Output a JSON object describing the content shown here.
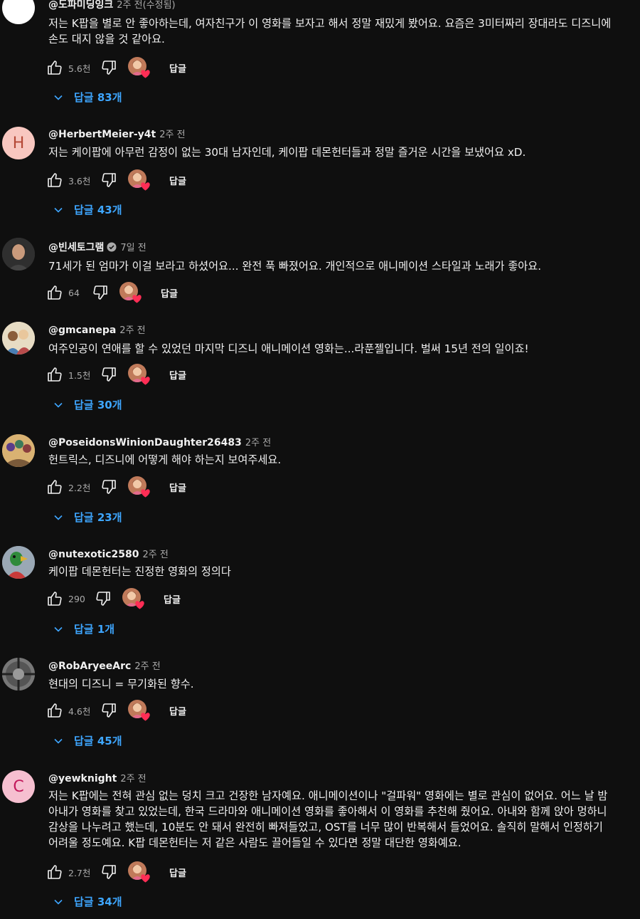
{
  "reply_label": "답글",
  "comments": [
    {
      "handle": "@도파미딩잉크",
      "time": "2주 전(수정됨)",
      "text": "저는 K팝을 별로 안 좋아하는데, 여자친구가 이 영화를 보자고 해서 정말 재밌게 봤어요. 요즘은 3미터짜리 장대라도 디즈니에 손도 대지 않을 것 같아요.",
      "likes": "5.6천",
      "replies": "답글 83개",
      "avatar_letter": "",
      "avatar_color": "#ffffff"
    },
    {
      "handle": "@HerbertMeier-y4t",
      "time": "2주 전",
      "text": "저는 케이팝에 아무런 감정이 없는 30대 남자인데, 케이팝 데몬헌터들과 정말 즐거운 시간을 보냈어요 xD.",
      "likes": "3.6천",
      "replies": "답글 43개",
      "avatar_letter": "H",
      "avatar_color": "#f8c7c0"
    },
    {
      "handle": "@빈세토그램",
      "time": "7일 전",
      "text": "71세가 된 엄마가 이걸 보라고 하셨어요... 완전 푹 빠졌어요. 개인적으로 애니메이션 스타일과 노래가 좋아요.",
      "likes": "64",
      "replies": "",
      "avatar_letter": "",
      "avatar_color": "#3a3a3a"
    },
    {
      "handle": "@gmcanepa",
      "time": "2주 전",
      "text": "여주인공이 연애를 할 수 있었던 마지막 디즈니 애니메이션 영화는...라푼젤입니다. 벌써 15년 전의 일이죠!",
      "likes": "1.5천",
      "replies": "답글 30개",
      "avatar_letter": "",
      "avatar_color": "#d8c6a8"
    },
    {
      "handle": "@PoseidonsWinionDaughter26483",
      "time": "2주 전",
      "text": "헌트릭스, 디즈니에 어떻게 해야 하는지 보여주세요.",
      "likes": "2.2천",
      "replies": "답글 23개",
      "avatar_letter": "",
      "avatar_color": "#c9a46a"
    },
    {
      "handle": "@nutexotic2580",
      "time": "2주 전",
      "text": "케이팝 데몬헌터는 진정한 영화의 정의다",
      "likes": "290",
      "replies": "답글 1개",
      "avatar_letter": "",
      "avatar_color": "#7d8fa0"
    },
    {
      "handle": "@RobAryeeArc",
      "time": "2주 전",
      "text": "현대의 디즈니 = 무기화된 향수.",
      "likes": "4.6천",
      "replies": "답글 45개",
      "avatar_letter": "",
      "avatar_color": "#6e6e6e"
    },
    {
      "handle": "@yewknight",
      "time": "2주 전",
      "text": "저는 K팝에는 전혀 관심 없는 덩치 크고 건장한 남자예요. 애니메이션이나 \"걸파워\" 영화에는 별로 관심이 없어요. 어느 날 밤 아내가 영화를 찾고 있었는데, 한국 드라마와 애니메이션 영화를 좋아해서 이 영화를 추천해 줬어요. 아내와 함께 앉아 멍하니 감상을 나누려고 했는데, 10분도 안 돼서 완전히 빠져들었고, OST를 너무 많이 반복해서 들었어요. 솔직히 말해서 인정하기 어려울 정도예요. K팝 데몬헌터는 저 같은 사람도 끌어들일 수 있다면 정말 대단한 영화예요.",
      "likes": "2.7천",
      "replies": "답글 34개",
      "avatar_letter": "C",
      "avatar_color": "#f6bfd0"
    }
  ]
}
